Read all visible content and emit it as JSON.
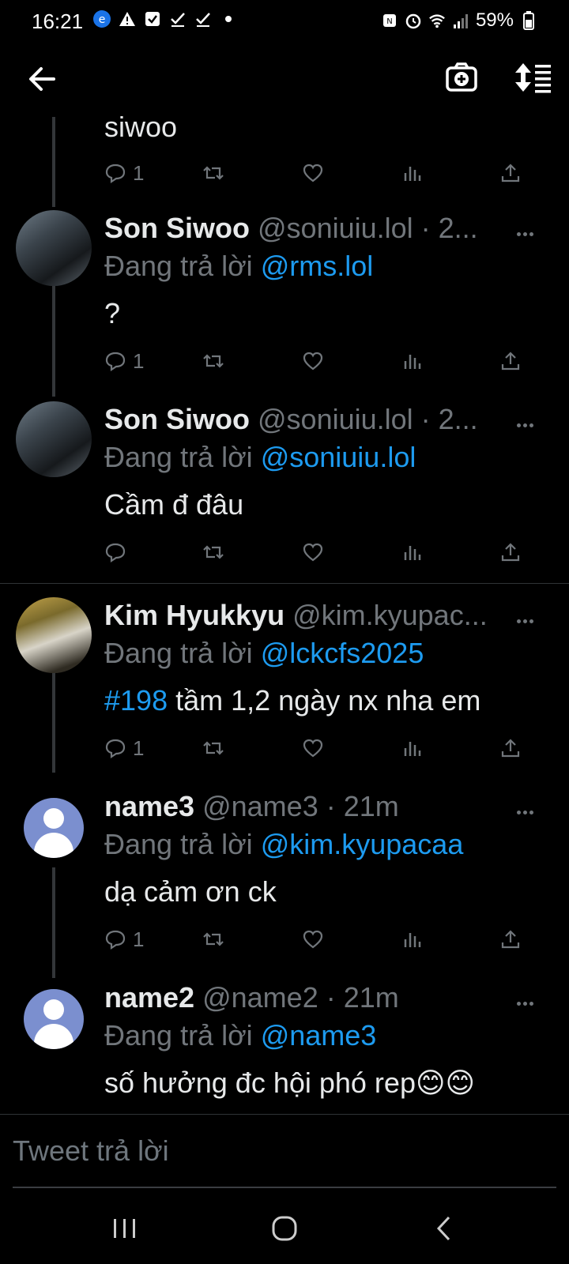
{
  "status_bar": {
    "time": "16:21",
    "battery": "59%",
    "left_icons": [
      "app-icon",
      "warning-icon",
      "checkbox-icon",
      "check-icon",
      "check-icon",
      "dot-icon"
    ],
    "right_icons": [
      "nfc-icon",
      "alarm-icon",
      "wifi-icon",
      "signal-icon",
      "battery-icon"
    ]
  },
  "topbar": {
    "back_icon": "arrow-left-icon",
    "camera_icon": "camera-plus-icon",
    "sort_icon": "sort-icon"
  },
  "tweets": [
    {
      "body": "siwoo",
      "counts": {
        "reply": "1"
      }
    },
    {
      "name": "Son Siwoo",
      "handle": "@soniuiu.lol · 2...",
      "reply_prefix": "Đang trả lời",
      "reply_to": "@rms.lol",
      "body": "?",
      "counts": {
        "reply": "1"
      }
    },
    {
      "name": "Son Siwoo",
      "handle": "@soniuiu.lol · 2...",
      "reply_prefix": "Đang trả lời",
      "reply_to": "@soniuiu.lol",
      "body": "Cầm đ đâu",
      "counts": {
        "reply": ""
      }
    },
    {
      "name": "Kim Hyukkyu",
      "handle": "@kim.kyupac...",
      "reply_prefix": "Đang trả lời",
      "reply_to": "@lckcfs2025",
      "body_tag": "#198",
      "body": " tầm 1,2 ngày nx nha em",
      "counts": {
        "reply": "1"
      }
    },
    {
      "name": "name3",
      "handle": "@name3 · 21m",
      "reply_prefix": "Đang trả lời",
      "reply_to": "@kim.kyupacaa",
      "body": "dạ cảm ơn ck",
      "counts": {
        "reply": "1"
      }
    },
    {
      "name": "name2",
      "handle": "@name2 · 21m",
      "reply_prefix": "Đang trả lời",
      "reply_to": "@name3",
      "body": "số hưởng đc hội phó rep😊😊"
    }
  ],
  "compose": {
    "placeholder": "Tweet trả lời"
  },
  "nav": {
    "recents": "|||",
    "home": "○",
    "back": "<"
  },
  "colors": {
    "accent": "#1d9bf0",
    "muted": "#71767b",
    "background": "#000000"
  }
}
